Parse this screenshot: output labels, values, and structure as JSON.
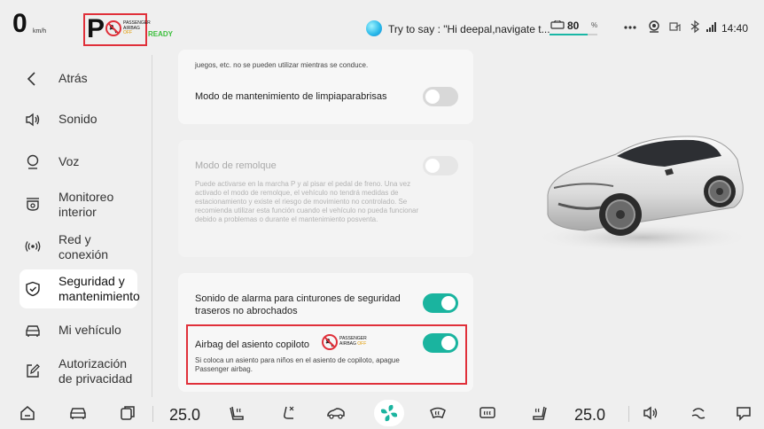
{
  "status": {
    "speed": "0",
    "speed_unit": "km/h",
    "gear": "P",
    "indicator_line1": "PASSENGER",
    "indicator_line2": "AIRBAG",
    "indicator_off": "OFF",
    "ready": "READY",
    "voice_prompt": "Try to say : \"Hi deepal,navigate t...",
    "battery_value": "80",
    "battery_unit": "%",
    "battery_level": 0.8,
    "time": "14:40",
    "accent_color": "#1ab49f",
    "icons": [
      "car-battery-icon",
      "more-icon",
      "driver-monitor-icon",
      "phone-projection-icon",
      "bluetooth-icon",
      "signal-icon"
    ]
  },
  "sidebar": {
    "items": [
      {
        "label": "Atrás",
        "icon": "back-chevron-icon"
      },
      {
        "label": "Sonido",
        "icon": "speaker-icon"
      },
      {
        "label": "Voz",
        "icon": "voice-icon"
      },
      {
        "label": "Monitoreo interior",
        "icon": "camera-icon"
      },
      {
        "label": "Red y conexión",
        "icon": "wireless-icon"
      },
      {
        "label": "Seguridad y mantenimiento",
        "icon": "shield-icon",
        "active": true
      },
      {
        "label": "Mi vehículo",
        "icon": "car-icon"
      },
      {
        "label": "Autorización de privacidad",
        "icon": "edit-icon"
      }
    ]
  },
  "settings": {
    "truncated_text": "juegos, etc. no se pueden utilizar mientras se conduce.",
    "wiper_label": "Modo de mantenimiento de limpiaparabrisas",
    "tow_title": "Modo de remolque",
    "tow_description": "Puede activarse en la marcha P y al pisar el pedal de freno. Una vez activado el modo de remolque, el vehículo no tendrá medidas de estacionamiento y existe el riesgo de movimiento no controlado. Se recomienda utilizar esta función cuando el vehículo no pueda funcionar debido a problemas o durante el mantenimiento posventa.",
    "seatbelt_label": "Sonido de alarma para cinturones de seguridad traseros no abrochados",
    "airbag_label": "Airbag del asiento copiloto",
    "airbag_description": "Si coloca un asiento para niños en el asiento de copiloto, apague Passenger airbag.",
    "airbag_ind_line1": "PASSENGER",
    "airbag_ind_line2": "AIRBAG",
    "airbag_ind_off": "OFF",
    "toggles": {
      "wiper": false,
      "tow": false,
      "seatbelt": true,
      "airbag": true
    }
  },
  "bottombar": {
    "temp_left": "25.0",
    "temp_right": "25.0",
    "icons": [
      "home-icon",
      "car-icon",
      "apps-icon",
      "seat-heat-icon",
      "seat-adjust-icon",
      "car-mode-icon",
      "fan-icon",
      "defrost-front-icon",
      "defrost-rear-icon",
      "seat-heat-right-icon",
      "volume-icon",
      "steering-icon",
      "chat-icon"
    ]
  }
}
